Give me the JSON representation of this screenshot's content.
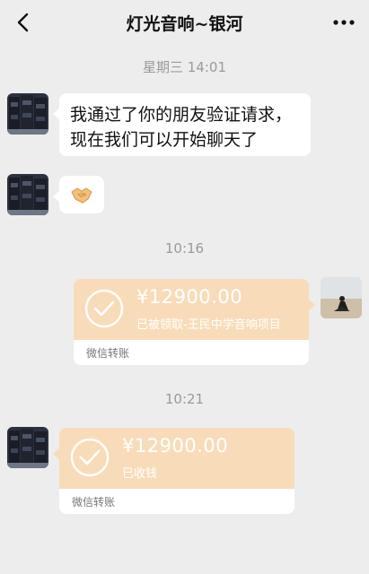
{
  "header": {
    "back_icon": "chevron-left-icon",
    "title": "灯光音响~银河",
    "more_icon": "more-icon"
  },
  "messages": {
    "time1": "星期三 14:01",
    "msg1_line1": "我通过了你的朋友验证请求，",
    "msg1_line2": "现在我们可以开始聊天了",
    "msg2_emoji": "🤝",
    "time2": "10:16",
    "transfer1": {
      "amount": "¥12900.00",
      "status": "已被领取-王民中学音响项目",
      "footer": "微信转账"
    },
    "time3": "10:21",
    "transfer2": {
      "amount": "¥12900.00",
      "status": "已收钱",
      "footer": "微信转账"
    }
  },
  "colors": {
    "background": "#ededed",
    "transfer_card": "#f8dcb9",
    "bubble": "#ffffff"
  }
}
